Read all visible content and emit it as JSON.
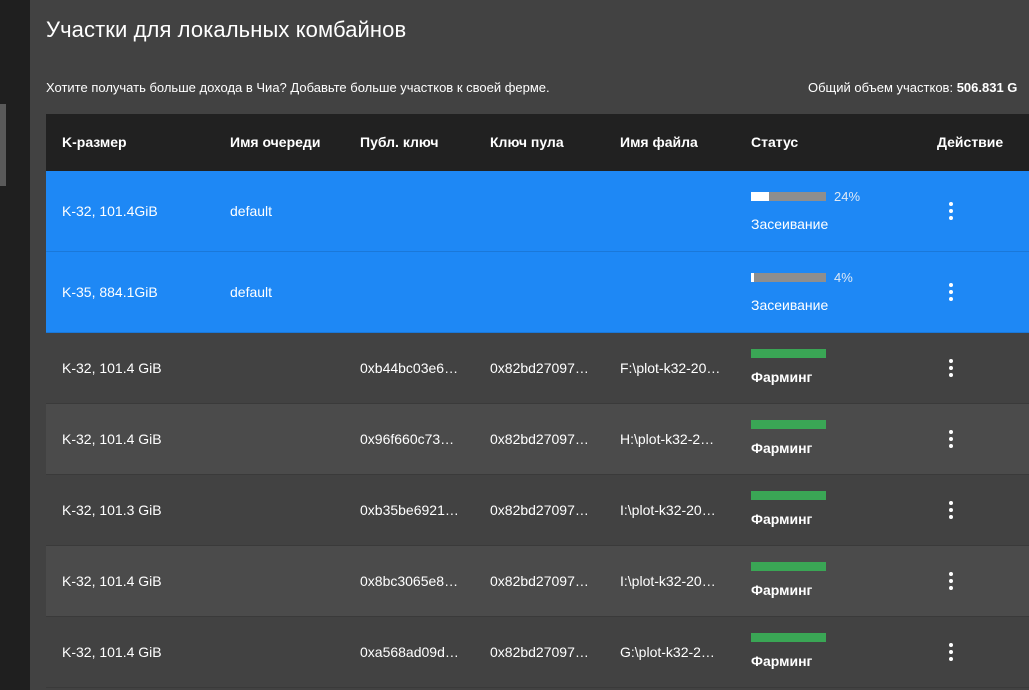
{
  "page": {
    "title": "Участки для локальных комбайнов",
    "subtitle": "Хотите получать больше дохода в Чиа? Добавьте больше участков к своей ферме.",
    "total_label": "Общий объем участков:",
    "total_value": "506.831 G"
  },
  "table": {
    "headers": {
      "k_size": "K-размер",
      "queue": "Имя очереди",
      "pub_key": "Публ. ключ",
      "pool_key": "Ключ пула",
      "filename": "Имя файла",
      "status": "Статус",
      "action": "Действие"
    },
    "rows": [
      {
        "k_size": "K-32, 101.4GiB",
        "queue": "default",
        "pub_key": "",
        "pool_key": "",
        "filename": "",
        "status": "Засеивание",
        "progress": 24,
        "progress_text": "24%",
        "state": "plotting"
      },
      {
        "k_size": "K-35, 884.1GiB",
        "queue": "default",
        "pub_key": "",
        "pool_key": "",
        "filename": "",
        "status": "Засеивание",
        "progress": 4,
        "progress_text": "4%",
        "state": "plotting"
      },
      {
        "k_size": "K-32, 101.4 GiB",
        "queue": "",
        "pub_key": "0xb44bc03e6…",
        "pool_key": "0x82bd27097…",
        "filename": "F:\\plot-k32-20…",
        "status": "Фарминг",
        "state": "farming"
      },
      {
        "k_size": "K-32, 101.4 GiB",
        "queue": "",
        "pub_key": "0x96f660c73…",
        "pool_key": "0x82bd27097…",
        "filename": "H:\\plot-k32-2…",
        "status": "Фарминг",
        "state": "farming"
      },
      {
        "k_size": "K-32, 101.3 GiB",
        "queue": "",
        "pub_key": "0xb35be6921…",
        "pool_key": "0x82bd27097…",
        "filename": "I:\\plot-k32-20…",
        "status": "Фарминг",
        "state": "farming"
      },
      {
        "k_size": "K-32, 101.4 GiB",
        "queue": "",
        "pub_key": "0x8bc3065e8…",
        "pool_key": "0x82bd27097…",
        "filename": "I:\\plot-k32-20…",
        "status": "Фарминг",
        "state": "farming"
      },
      {
        "k_size": "K-32, 101.4 GiB",
        "queue": "",
        "pub_key": "0xa568ad09d…",
        "pool_key": "0x82bd27097…",
        "filename": "G:\\plot-k32-2…",
        "status": "Фарминг",
        "state": "farming"
      }
    ],
    "action_icon": "more-vert-icon"
  },
  "colors": {
    "plotting_row": "#1e88f5",
    "farming_bar": "#3aa655",
    "header_bg": "#212121"
  }
}
